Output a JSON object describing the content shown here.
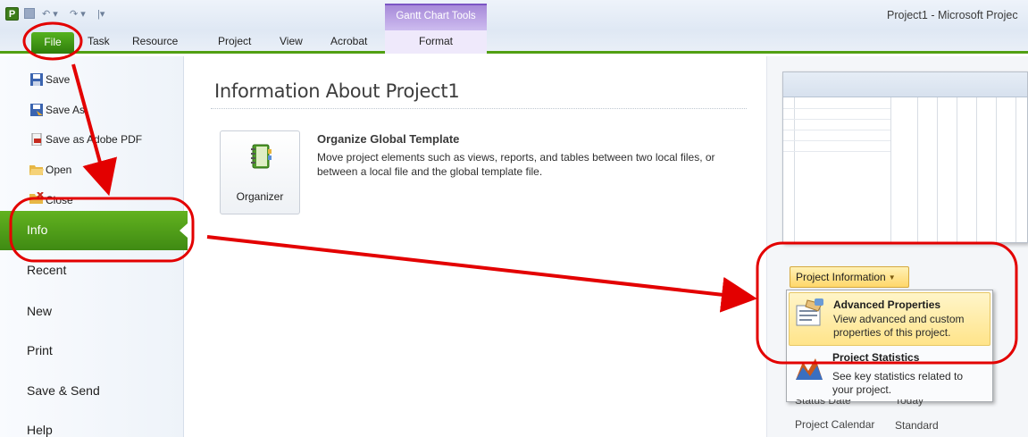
{
  "app": {
    "logo_letter": "P",
    "window_title": "Project1 - Microsoft Projec"
  },
  "qat": {
    "undo_icon": "undo-icon",
    "redo_icon": "redo-icon",
    "customize_icon": "customize-qat-icon"
  },
  "ribbon": {
    "contextual_group": "Gantt Chart Tools",
    "tabs": {
      "file": "File",
      "task": "Task",
      "resource": "Resource",
      "project": "Project",
      "view": "View",
      "acrobat": "Acrobat",
      "format": "Format"
    }
  },
  "backstage": {
    "commands": {
      "save": "Save",
      "save_as": "Save As",
      "save_as_pdf": "Save as Adobe PDF",
      "open": "Open",
      "close": "Close"
    },
    "sections": {
      "info": "Info",
      "recent": "Recent",
      "new": "New",
      "print": "Print",
      "save_send": "Save & Send",
      "help": "Help"
    }
  },
  "info": {
    "title": "Information About Project1",
    "organizer": {
      "button_label": "Organizer",
      "heading": "Organize Global Template",
      "description": "Move project elements such as views, reports, and tables between two local files, or between a local file and the global template file."
    }
  },
  "project_information": {
    "button_label": "Project Information",
    "menu": [
      {
        "title": "Advanced Properties",
        "description": "View advanced and custom properties of this project.",
        "icon": "advanced-properties-icon",
        "highlighted": true
      },
      {
        "title": "Project Statistics",
        "description": "See key statistics related to your project.",
        "icon": "project-statistics-icon",
        "highlighted": false
      }
    ],
    "properties": {
      "status_date_label": "Status Date",
      "status_date_value": "Today",
      "calendar_label": "Project Calendar",
      "calendar_value": "Standard"
    }
  },
  "colors": {
    "file_tab": "#3f8a13",
    "info_selected": "#4f9f18",
    "contextual_purple": "#a78ad9",
    "highlight_yellow": "#ffe48a",
    "annotation_red": "#e30000"
  }
}
